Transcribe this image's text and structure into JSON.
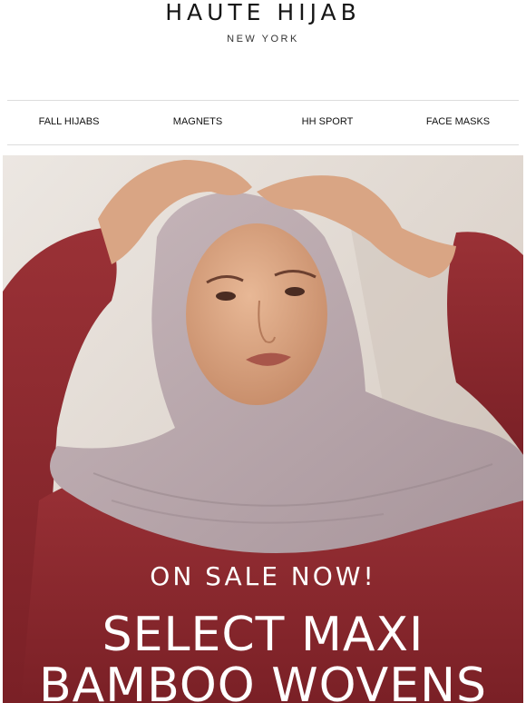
{
  "header": {
    "brand": "HAUTE HIJAB",
    "subtitle": "NEW YORK"
  },
  "nav": {
    "items": [
      {
        "label": "FALL HIJABS"
      },
      {
        "label": "MAGNETS"
      },
      {
        "label": "HH SPORT"
      },
      {
        "label": "FACE MASKS"
      }
    ]
  },
  "hero": {
    "eyebrow": "ON SALE NOW!",
    "title_line1": "SELECT MAXI",
    "title_line2": "BAMBOO WOVENS",
    "colors": {
      "dress": "#8e2a2f",
      "hijab": "#b9a8ad",
      "background": "#e3dcd5",
      "skin": "#d9a584"
    }
  }
}
